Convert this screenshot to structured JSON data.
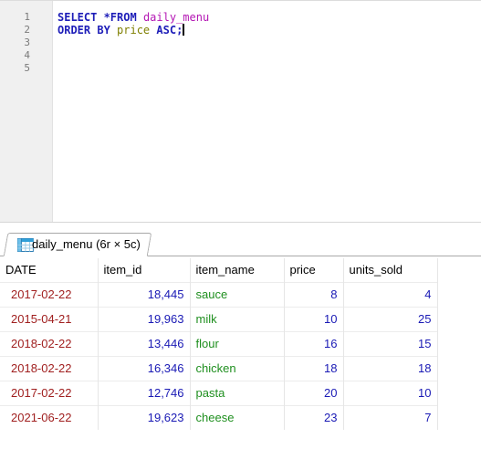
{
  "editor": {
    "line_numbers": [
      "1",
      "2",
      "3",
      "4",
      "5"
    ],
    "line1": {
      "kw1": "SELECT *FROM",
      "ident": "daily_menu"
    },
    "line2": {
      "kw1": "ORDER BY",
      "ident": "price",
      "kw2": "ASC;"
    }
  },
  "result_tab": {
    "label": "daily_menu (6r × 5c)",
    "icon": "table-grid-icon"
  },
  "grid": {
    "columns": [
      "DATE",
      "item_id",
      "item_name",
      "price",
      "units_sold"
    ],
    "rows": [
      [
        "2017-02-22",
        "18,445",
        "sauce",
        "8",
        "4"
      ],
      [
        "2015-04-21",
        "19,963",
        "milk",
        "10",
        "25"
      ],
      [
        "2018-02-22",
        "13,446",
        "flour",
        "16",
        "15"
      ],
      [
        "2018-02-22",
        "16,346",
        "chicken",
        "18",
        "18"
      ],
      [
        "2017-02-22",
        "12,746",
        "pasta",
        "20",
        "10"
      ],
      [
        "2021-06-22",
        "19,623",
        "cheese",
        "23",
        "7"
      ]
    ]
  },
  "colors": {
    "keyword": "#1d1db8",
    "table_identifier": "#b417b4",
    "column_identifier": "#7f7f00",
    "date_value": "#a01f1f",
    "number_value": "#1a1ab5",
    "text_value": "#1f8f1f"
  }
}
